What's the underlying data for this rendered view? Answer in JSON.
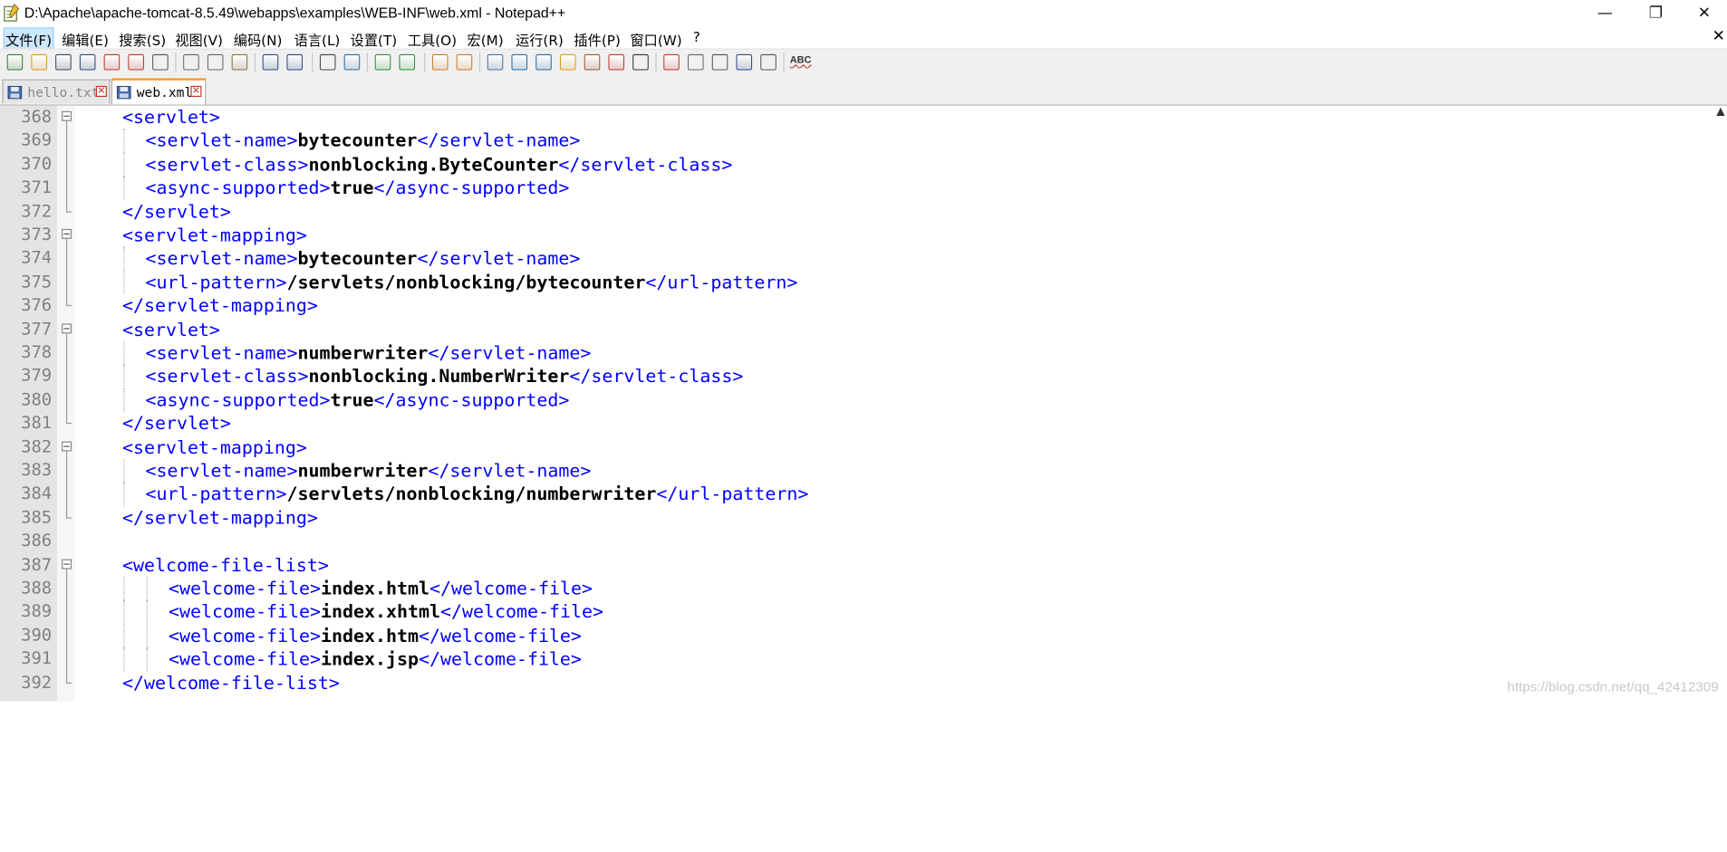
{
  "window": {
    "title": "D:\\Apache\\apache-tomcat-8.5.49\\webapps\\examples\\WEB-INF\\web.xml - Notepad++",
    "minimize_glyph": "—",
    "maximize_glyph": "❐",
    "close_glyph": "✕"
  },
  "menu": {
    "items": [
      "文件(F)",
      "编辑(E)",
      "搜索(S)",
      "视图(V)",
      "编码(N)",
      "语言(L)",
      "设置(T)",
      "工具(O)",
      "宏(M)",
      "运行(R)",
      "插件(P)",
      "窗口(W)",
      "?"
    ],
    "close_glyph": "✕"
  },
  "toolbar": {
    "icons": [
      "new-file-icon",
      "open-file-icon",
      "save-icon",
      "save-all-icon",
      "close-icon",
      "close-all-icon",
      "print-icon",
      "cut-icon",
      "copy-icon",
      "paste-icon",
      "undo-icon",
      "redo-icon",
      "find-icon",
      "replace-icon",
      "zoom-in-icon",
      "zoom-out-icon",
      "sync-vertical-icon",
      "sync-horizontal-icon",
      "word-wrap-icon",
      "show-all-chars-icon",
      "indent-guide-icon",
      "document-map-icon",
      "function-list-icon",
      "folder-workspace-icon",
      "monitor-icon",
      "record-macro-icon",
      "stop-record-icon",
      "play-macro-icon",
      "run-macro-multiple-icon",
      "save-macro-icon",
      "spell-check-icon"
    ],
    "spellcheck_label": "ABC"
  },
  "tabs": [
    {
      "label": "hello.txt",
      "active": false
    },
    {
      "label": "web.xml",
      "active": true
    }
  ],
  "editor": {
    "lines": [
      {
        "num": "368",
        "indent": 2,
        "fold": "open",
        "parts": [
          [
            "t",
            "<servlet>"
          ]
        ]
      },
      {
        "num": "369",
        "indent": 3,
        "fold": "line",
        "parts": [
          [
            "t",
            "<servlet-name>"
          ],
          [
            "v",
            "bytecounter"
          ],
          [
            "t",
            "</servlet-name>"
          ]
        ]
      },
      {
        "num": "370",
        "indent": 3,
        "fold": "line",
        "parts": [
          [
            "t",
            "<servlet-class>"
          ],
          [
            "v",
            "nonblocking.ByteCounter"
          ],
          [
            "t",
            "</servlet-class>"
          ]
        ]
      },
      {
        "num": "371",
        "indent": 3,
        "fold": "line",
        "parts": [
          [
            "t",
            "<async-supported>"
          ],
          [
            "v",
            "true"
          ],
          [
            "t",
            "</async-supported>"
          ]
        ]
      },
      {
        "num": "372",
        "indent": 2,
        "fold": "end",
        "parts": [
          [
            "t",
            "</servlet>"
          ]
        ]
      },
      {
        "num": "373",
        "indent": 2,
        "fold": "open",
        "parts": [
          [
            "t",
            "<servlet-mapping>"
          ]
        ]
      },
      {
        "num": "374",
        "indent": 3,
        "fold": "line",
        "parts": [
          [
            "t",
            "<servlet-name>"
          ],
          [
            "v",
            "bytecounter"
          ],
          [
            "t",
            "</servlet-name>"
          ]
        ]
      },
      {
        "num": "375",
        "indent": 3,
        "fold": "line",
        "parts": [
          [
            "t",
            "<url-pattern>"
          ],
          [
            "v",
            "/servlets/nonblocking/bytecounter"
          ],
          [
            "t",
            "</url-pattern>"
          ]
        ]
      },
      {
        "num": "376",
        "indent": 2,
        "fold": "end",
        "parts": [
          [
            "t",
            "</servlet-mapping>"
          ]
        ]
      },
      {
        "num": "377",
        "indent": 2,
        "fold": "open",
        "parts": [
          [
            "t",
            "<servlet>"
          ]
        ]
      },
      {
        "num": "378",
        "indent": 3,
        "fold": "line",
        "parts": [
          [
            "t",
            "<servlet-name>"
          ],
          [
            "v",
            "numberwriter"
          ],
          [
            "t",
            "</servlet-name>"
          ]
        ]
      },
      {
        "num": "379",
        "indent": 3,
        "fold": "line",
        "parts": [
          [
            "t",
            "<servlet-class>"
          ],
          [
            "v",
            "nonblocking.NumberWriter"
          ],
          [
            "t",
            "</servlet-class>"
          ]
        ]
      },
      {
        "num": "380",
        "indent": 3,
        "fold": "line",
        "parts": [
          [
            "t",
            "<async-supported>"
          ],
          [
            "v",
            "true"
          ],
          [
            "t",
            "</async-supported>"
          ]
        ]
      },
      {
        "num": "381",
        "indent": 2,
        "fold": "end",
        "parts": [
          [
            "t",
            "</servlet>"
          ]
        ]
      },
      {
        "num": "382",
        "indent": 2,
        "fold": "open",
        "parts": [
          [
            "t",
            "<servlet-mapping>"
          ]
        ]
      },
      {
        "num": "383",
        "indent": 3,
        "fold": "line",
        "parts": [
          [
            "t",
            "<servlet-name>"
          ],
          [
            "v",
            "numberwriter"
          ],
          [
            "t",
            "</servlet-name>"
          ]
        ]
      },
      {
        "num": "384",
        "indent": 3,
        "fold": "line",
        "parts": [
          [
            "t",
            "<url-pattern>"
          ],
          [
            "v",
            "/servlets/nonblocking/numberwriter"
          ],
          [
            "t",
            "</url-pattern>"
          ]
        ]
      },
      {
        "num": "385",
        "indent": 2,
        "fold": "end",
        "parts": [
          [
            "t",
            "</servlet-mapping>"
          ]
        ]
      },
      {
        "num": "386",
        "indent": 0,
        "fold": "none",
        "parts": []
      },
      {
        "num": "387",
        "indent": 2,
        "fold": "open",
        "parts": [
          [
            "t",
            "<welcome-file-list>"
          ]
        ]
      },
      {
        "num": "388",
        "indent": 4,
        "fold": "line",
        "parts": [
          [
            "t",
            "<welcome-file>"
          ],
          [
            "v",
            "index.html"
          ],
          [
            "t",
            "</welcome-file>"
          ]
        ]
      },
      {
        "num": "389",
        "indent": 4,
        "fold": "line",
        "parts": [
          [
            "t",
            "<welcome-file>"
          ],
          [
            "v",
            "index.xhtml"
          ],
          [
            "t",
            "</welcome-file>"
          ]
        ]
      },
      {
        "num": "390",
        "indent": 4,
        "fold": "line",
        "parts": [
          [
            "t",
            "<welcome-file>"
          ],
          [
            "v",
            "index.htm"
          ],
          [
            "t",
            "</welcome-file>"
          ]
        ]
      },
      {
        "num": "391",
        "indent": 4,
        "fold": "line",
        "parts": [
          [
            "t",
            "<welcome-file>"
          ],
          [
            "v",
            "index.jsp"
          ],
          [
            "t",
            "</welcome-file>"
          ]
        ]
      },
      {
        "num": "392",
        "indent": 2,
        "fold": "end",
        "parts": [
          [
            "t",
            "</welcome-file-list>"
          ]
        ]
      }
    ]
  },
  "watermark": "https://blog.csdn.net/qq_42412309"
}
